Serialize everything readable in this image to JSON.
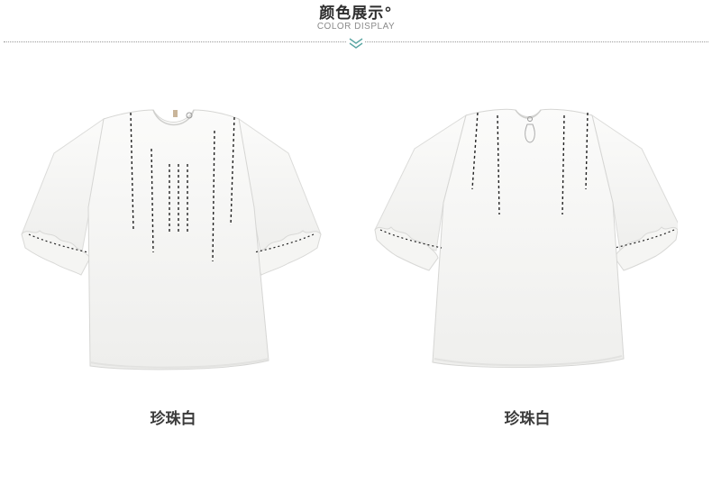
{
  "header": {
    "title": "颜色展示°",
    "subtitle": "COLOR DISPLAY"
  },
  "products": [
    {
      "view": "front",
      "color_name": "珍珠白"
    },
    {
      "view": "back",
      "color_name": "珍珠白"
    }
  ],
  "colors": {
    "garment": "#f7f7f5",
    "stitch": "#222222",
    "accent": "#5aa6a3"
  }
}
